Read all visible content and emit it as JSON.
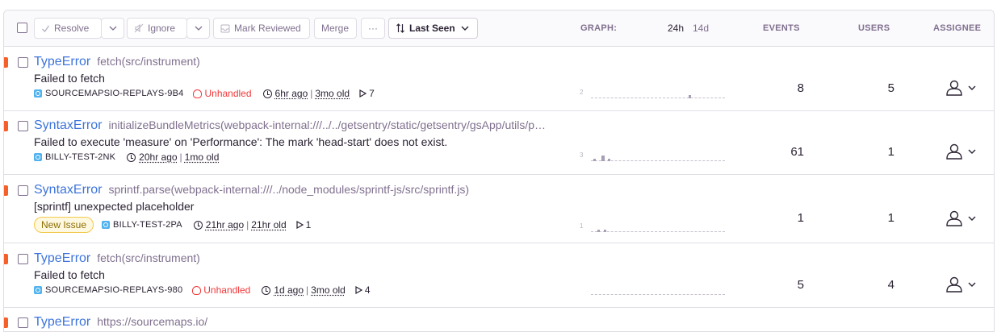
{
  "toolbar": {
    "resolve_label": "Resolve",
    "ignore_label": "Ignore",
    "mark_reviewed_label": "Mark Reviewed",
    "merge_label": "Merge",
    "more_label": "···",
    "sort_label": "Last Seen"
  },
  "columns": {
    "graph": "GRAPH:",
    "range_24h": "24h",
    "range_14d": "14d",
    "events": "EVENTS",
    "users": "USERS",
    "assignee": "ASSIGNEE"
  },
  "issues": [
    {
      "type": "TypeError",
      "culprit": "fetch(src/instrument)",
      "message": "Failed to fetch",
      "short_id": "SOURCEMAPSIO-REPLAYS-9B4",
      "unhandled": "Unhandled",
      "last_seen": "6hr ago",
      "first_seen": "3mo old",
      "replays": "7",
      "graph_max": "2",
      "events": "8",
      "users": "5"
    },
    {
      "type": "SyntaxError",
      "culprit": "initializeBundleMetrics(webpack-internal:///../../getsentry/static/getsentry/gsApp/utils/performanceForSentry.tsx)",
      "message": "Failed to execute 'measure' on 'Performance': The mark 'head-start' does not exist.",
      "short_id": "BILLY-TEST-2NK",
      "last_seen": "20hr ago",
      "first_seen": "1mo old",
      "graph_max": "3",
      "events": "61",
      "users": "1"
    },
    {
      "type": "SyntaxError",
      "culprit": "sprintf.parse(webpack-internal:///../node_modules/sprintf-js/src/sprintf.js)",
      "message": "[sprintf] unexpected placeholder",
      "badge": "New Issue",
      "short_id": "BILLY-TEST-2PA",
      "last_seen": "21hr ago",
      "first_seen": "21hr old",
      "replays": "1",
      "graph_max": "1",
      "events": "1",
      "users": "1"
    },
    {
      "type": "TypeError",
      "culprit": "fetch(src/instrument)",
      "message": "Failed to fetch",
      "short_id": "SOURCEMAPSIO-REPLAYS-980",
      "unhandled": "Unhandled",
      "last_seen": "1d ago",
      "first_seen": "3mo old",
      "replays": "4",
      "events": "5",
      "users": "4"
    },
    {
      "type": "TypeError",
      "culprit": "https://sourcemaps.io/"
    }
  ],
  "colors": {
    "accent": "#3d74db",
    "level_error": "#f55f2a",
    "unhandled": "#f0383a",
    "muted": "#80708f"
  }
}
